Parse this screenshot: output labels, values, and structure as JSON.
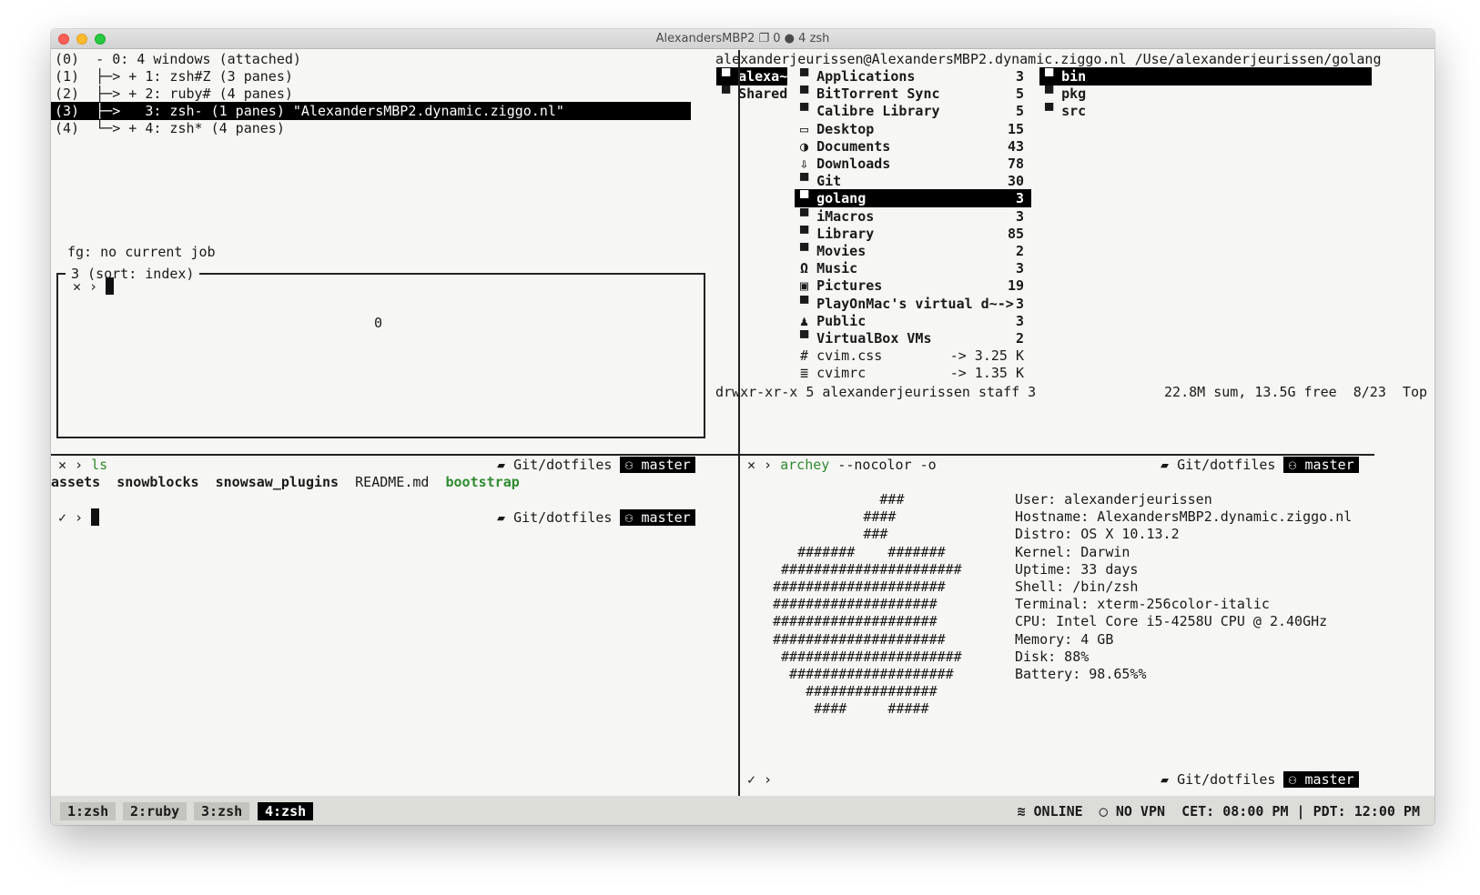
{
  "window": {
    "title": "AlexandersMBP2 ❐ 0 ● 4 zsh"
  },
  "tree": {
    "lines": [
      "(0)  - 0: 4 windows (attached)",
      "(1)  ├─> + 1: zsh#Z (3 panes)",
      "(2)  ├─> + 2: ruby# (4 panes)",
      "(3)  ├─>   3: zsh- (1 panes) \"AlexandersMBP2.dynamic.ziggo.nl\"",
      "(4)  └─> + 4: zsh* (4 panes)"
    ],
    "preview_title": "3 (sort: index)",
    "preview_line1": "fg: no current job",
    "preview_prompt": "✕ ›",
    "preview_number": "0"
  },
  "ranger": {
    "header": "alexanderjeurissen@AlexandersMBP2.dynamic.ziggo.nl /Use/alexanderjeurissen/golang",
    "col1": [
      "alexa~",
      "Shared"
    ],
    "col2": [
      {
        "icon": "folder-icon",
        "glyph": "▀",
        "name": "Applications",
        "count": "3"
      },
      {
        "icon": "folder-icon",
        "glyph": "▀",
        "name": "BitTorrent Sync",
        "count": "5"
      },
      {
        "icon": "folder-icon",
        "glyph": "▀",
        "name": "Calibre Library",
        "count": "5"
      },
      {
        "icon": "monitor-icon",
        "glyph": "▭",
        "name": "Desktop",
        "count": "15"
      },
      {
        "icon": "document-icon",
        "glyph": "◑",
        "name": "Documents",
        "count": "43"
      },
      {
        "icon": "download-icon",
        "glyph": "⇩",
        "name": "Downloads",
        "count": "78"
      },
      {
        "icon": "folder-icon",
        "glyph": "▀",
        "name": "Git",
        "count": "30"
      },
      {
        "icon": "folder-icon",
        "glyph": "▀",
        "name": "golang",
        "count": "3"
      },
      {
        "icon": "folder-icon",
        "glyph": "▀",
        "name": "iMacros",
        "count": "3"
      },
      {
        "icon": "folder-icon",
        "glyph": "▀",
        "name": "Library",
        "count": "85"
      },
      {
        "icon": "folder-icon",
        "glyph": "▀",
        "name": "Movies",
        "count": "2"
      },
      {
        "icon": "headphones-icon",
        "glyph": "Ω",
        "name": "Music",
        "count": "3"
      },
      {
        "icon": "picture-icon",
        "glyph": "▣",
        "name": "Pictures",
        "count": "19"
      },
      {
        "icon": "folder-icon",
        "glyph": "▀",
        "name": "PlayOnMac's virtual d~->",
        "count": "3"
      },
      {
        "icon": "users-icon",
        "glyph": "♟",
        "name": "Public",
        "count": "3"
      },
      {
        "icon": "folder-icon",
        "glyph": "▀",
        "name": "VirtualBox VMs",
        "count": "2"
      },
      {
        "icon": "hash-icon",
        "glyph": "#",
        "name": "cvim.css",
        "count": "-> 3.25 K"
      },
      {
        "icon": "file-lines-icon",
        "glyph": "≣",
        "name": "cvimrc",
        "count": "-> 1.35 K"
      }
    ],
    "col3": [
      "bin",
      "pkg",
      "src"
    ],
    "footer_left": "drwxr-xr-x 5 alexanderjeurissen staff 3",
    "footer_right": "22.8M sum, 13.5G free  8/23  Top"
  },
  "left_shell": {
    "prompt1_x": "✕ ›",
    "cmd1": "ls",
    "ls_items": [
      "assets",
      "snowblocks",
      "snowsaw_plugins",
      "README.md",
      "bootstrap"
    ],
    "prompt2_check": "✓ ›",
    "path": "Git/dotfiles",
    "branch": "master"
  },
  "right_shell": {
    "prompt_x": "✕ ›",
    "cmd": "archey",
    "args": "--nocolor -o",
    "art": [
      "             ###",
      "           ####",
      "           ###",
      "   #######    #######",
      " ######################",
      "#####################",
      "####################",
      "####################",
      "#####################",
      " ######################",
      "  ####################",
      "    ################",
      "     ####     #####"
    ],
    "info": [
      "User: alexanderjeurissen",
      "Hostname: AlexandersMBP2.dynamic.ziggo.nl",
      "Distro: OS X 10.13.2",
      "Kernel: Darwin",
      "Uptime: 33 days",
      "Shell: /bin/zsh",
      "Terminal: xterm-256color-italic",
      "CPU: Intel Core i5-4258U CPU @ 2.40GHz",
      "Memory: 4 GB",
      "Disk: 88%",
      "Battery: 98.65%%"
    ],
    "prompt_check": "✓ ›",
    "path": "Git/dotfiles",
    "branch": "master"
  },
  "statusbar": {
    "tabs": [
      "1:zsh",
      "2:ruby",
      "3:zsh",
      "4:zsh"
    ],
    "active_tab": 3,
    "online": "ONLINE",
    "vpn": "NO VPN",
    "clock": "CET: 08:00 PM | PDT: 12:00 PM"
  }
}
